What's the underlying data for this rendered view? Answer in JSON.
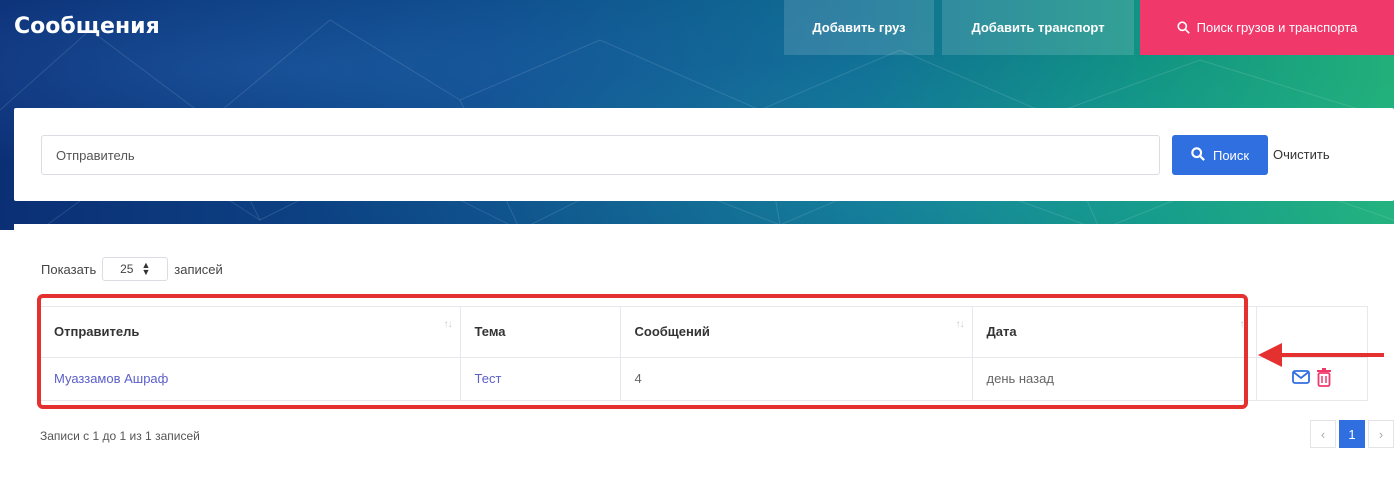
{
  "header": {
    "title": "Сообщения",
    "add_cargo_label": "Добавить груз",
    "add_transport_label": "Добавить транспорт",
    "search_cargo_transport_label": "Поиск грузов и транспорта"
  },
  "filter": {
    "sender_placeholder": "Отправитель",
    "search_label": "Поиск",
    "clear_label": "Очистить"
  },
  "list": {
    "show_prefix": "Показать",
    "page_size": "25",
    "show_suffix": "записей",
    "columns": [
      "Отправитель",
      "Тема",
      "Сообщений",
      "Дата"
    ],
    "rows": [
      {
        "sender": "Муаззамов Ашраф",
        "subject": "Тест",
        "count": "4",
        "date": "день назад"
      }
    ],
    "records_info": "Записи с 1 до 1 из 1 записей",
    "pagination": {
      "prev": "‹",
      "current": "1",
      "next": "›"
    }
  },
  "colors": {
    "accent_blue": "#2f6fe0",
    "accent_pink": "#f0386b",
    "highlight_red": "#e53030",
    "link_purple": "#5b5fc7"
  }
}
